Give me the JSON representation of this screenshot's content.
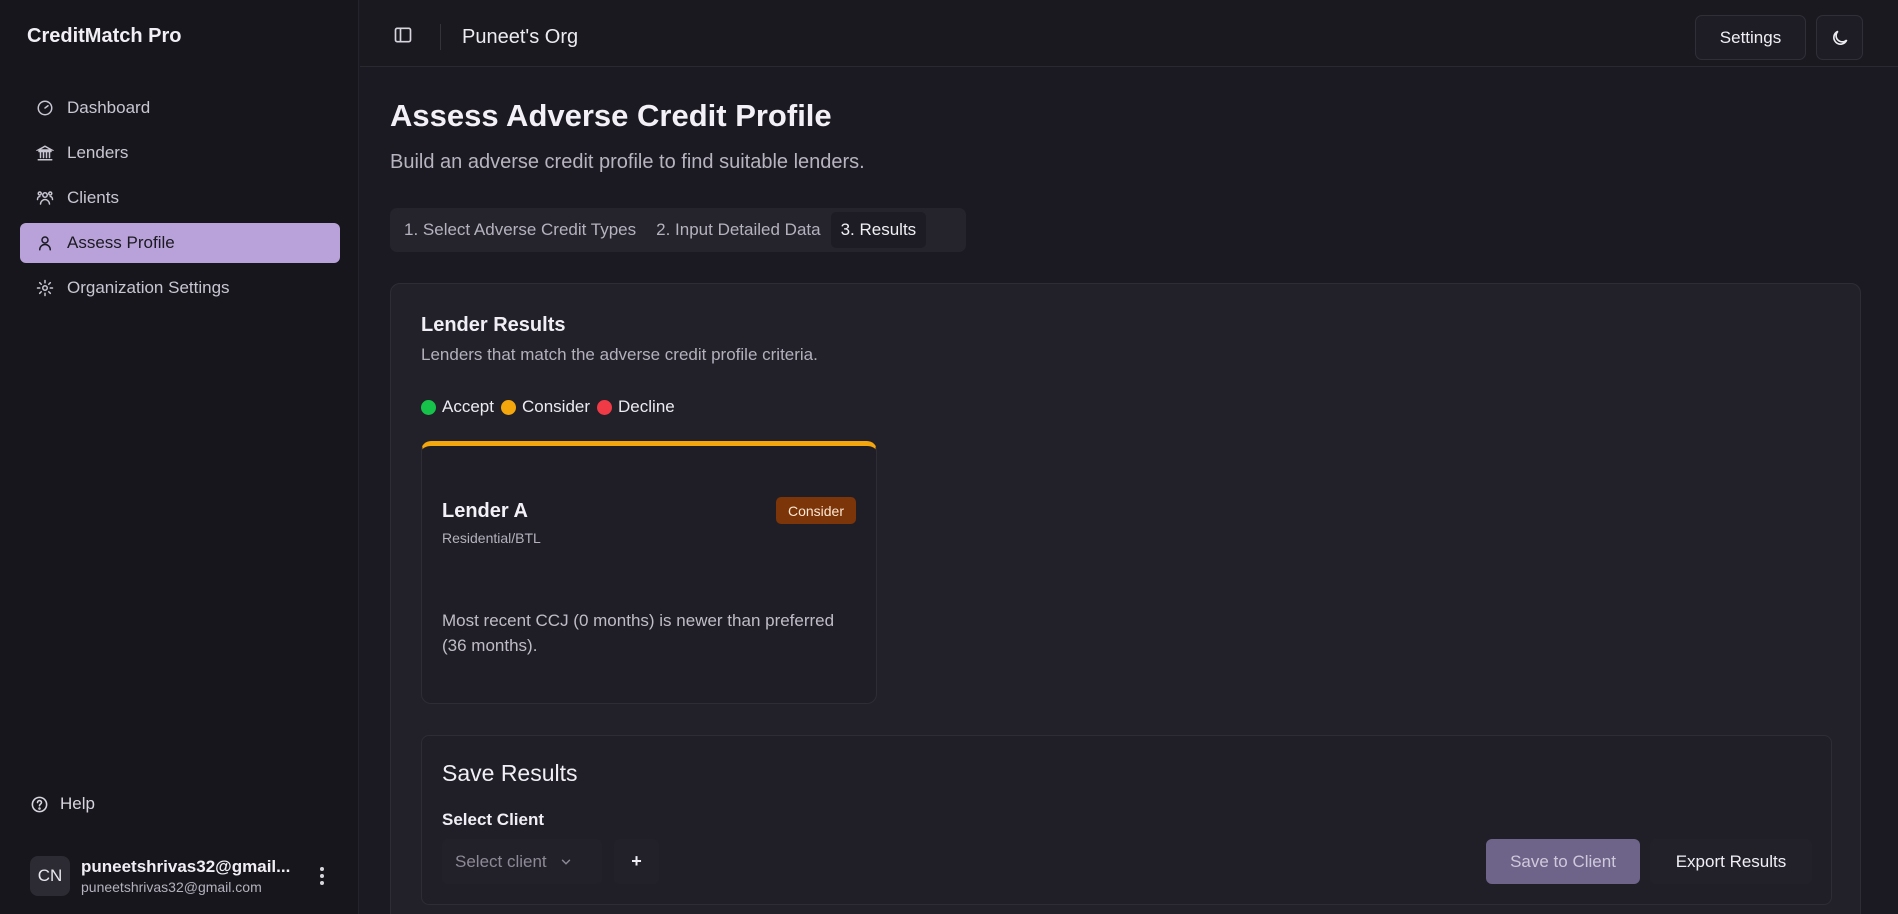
{
  "app": {
    "brand": "CreditMatch Pro"
  },
  "sidebar": {
    "items": [
      {
        "label": "Dashboard",
        "icon": "dashboard-icon"
      },
      {
        "label": "Lenders",
        "icon": "bank-icon"
      },
      {
        "label": "Clients",
        "icon": "users-icon"
      },
      {
        "label": "Assess Profile",
        "icon": "user-icon",
        "active": true
      },
      {
        "label": "Organization Settings",
        "icon": "gear-icon"
      }
    ],
    "help_label": "Help",
    "user": {
      "initials": "CN",
      "name": "puneetshrivas32@gmail...",
      "email": "puneetshrivas32@gmail.com"
    }
  },
  "topbar": {
    "org_name": "Puneet's Org",
    "settings_label": "Settings"
  },
  "main": {
    "title": "Assess Adverse Credit Profile",
    "subtitle": "Build an adverse credit profile to find suitable lenders.",
    "tabs": [
      {
        "label": "1. Select Adverse Credit Types"
      },
      {
        "label": "2. Input Detailed Data"
      },
      {
        "label": "3. Results",
        "active": true
      }
    ],
    "results": {
      "title": "Lender Results",
      "subtitle": "Lenders that match the adverse credit profile criteria.",
      "legend": [
        {
          "label": "Accept",
          "color": "#16c24a"
        },
        {
          "label": "Consider",
          "color": "#f4a60d"
        },
        {
          "label": "Decline",
          "color": "#f03a45"
        }
      ],
      "lenders": [
        {
          "name": "Lender A",
          "type": "Residential/BTL",
          "status": "Consider",
          "reason": "Most recent CCJ (0 months) is newer than preferred (36 months)."
        }
      ]
    },
    "save": {
      "title": "Save Results",
      "select_label": "Select Client",
      "select_placeholder": "Select client",
      "add_label": "+",
      "save_button": "Save to Client",
      "export_button": "Export Results"
    }
  },
  "colors": {
    "accent": "#b9a2d9",
    "consider": "#f4a60d",
    "consider_badge": "#7c3409"
  }
}
